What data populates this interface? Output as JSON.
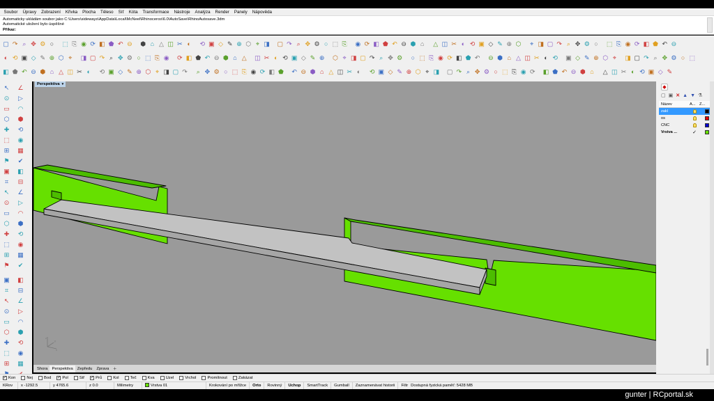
{
  "menubar": {
    "items": [
      "Soubor",
      "Úpravy",
      "Zobrazení",
      "Křivka",
      "Plocha",
      "Těleso",
      "Síť",
      "Kóta",
      "Transformace",
      "Nástroje",
      "Analýza",
      "Render",
      "Panely",
      "Nápověda"
    ]
  },
  "command_history": {
    "lines": [
      "Automaticky ukládám soubor jako C:\\Users\\sideways\\AppData\\Local\\McNeel\\Rhinoceros\\6.0\\AutoSave\\RhinoAutosave.3dm",
      "Automatické uložení bylo úspěšné"
    ],
    "prompt_label": "Příkaz:",
    "input_value": ""
  },
  "viewport": {
    "active_title": "Perspektiva",
    "dropdown_glyph": "▾",
    "object_colors": {
      "green": "#66e000",
      "green_side": "#4cbd00",
      "plate_top": "#c2c2c2",
      "plate_side": "#a6a6a6",
      "outline": "#000000",
      "background": "#9a9a9a"
    },
    "axis_labels": {
      "x": "x",
      "y": "y",
      "z": "z"
    }
  },
  "view_tabs": {
    "tabs": [
      "Shora",
      "Perspektiva",
      "Zepředu",
      "Zprava"
    ],
    "active": "Perspektiva",
    "add_glyph": "+"
  },
  "layers_panel": {
    "header": {
      "name": "Název",
      "col2": "A...",
      "col3": "Z..."
    },
    "rows": [
      {
        "name": "zakl",
        "color": "#000000",
        "selected": true,
        "current": false
      },
      {
        "name": "os",
        "color": "#e00000",
        "selected": false,
        "current": false
      },
      {
        "name": "CNC",
        "color": "#0000d0",
        "selected": false,
        "current": false
      },
      {
        "name": "Vrstva ...",
        "color": "#66e000",
        "selected": false,
        "current": true
      }
    ],
    "check_glyph": "✓"
  },
  "osnap_bar": {
    "items": [
      {
        "label": "Kon",
        "checked": true
      },
      {
        "label": "Nej",
        "checked": false
      },
      {
        "label": "Bod",
        "checked": false
      },
      {
        "label": "Pol",
        "checked": true
      },
      {
        "label": "Stř",
        "checked": false
      },
      {
        "label": "Prů",
        "checked": true
      },
      {
        "label": "Kol",
        "checked": false
      },
      {
        "label": "Teč",
        "checked": false
      },
      {
        "label": "Kva",
        "checked": false
      },
      {
        "label": "Uzel",
        "checked": false
      },
      {
        "label": "Vrchol",
        "checked": false
      },
      {
        "label": "Promítnout",
        "checked": false
      },
      {
        "label": "Zakázat",
        "checked": false
      }
    ],
    "check_glyph": "✓"
  },
  "status": {
    "cplane": "KRov",
    "x": "x -1292.5",
    "y": "y 4765.6",
    "z": "z 0.0",
    "units": "Milimetry",
    "layer": "Vrstva 01",
    "layer_color": "#66e000",
    "grid_snap": "Krokování po mřížce",
    "ortho": "Orto",
    "planar": "Rovinný",
    "osnap": "Uchop",
    "smarttrack": "SmartTrack",
    "gumball": "Gumball",
    "history": "Zaznamenávat historii",
    "filter": "Filtr",
    "memory": "Dostupná fyzická paměť: 5428 MB"
  },
  "watermark": "gunter | RCportal.sk"
}
